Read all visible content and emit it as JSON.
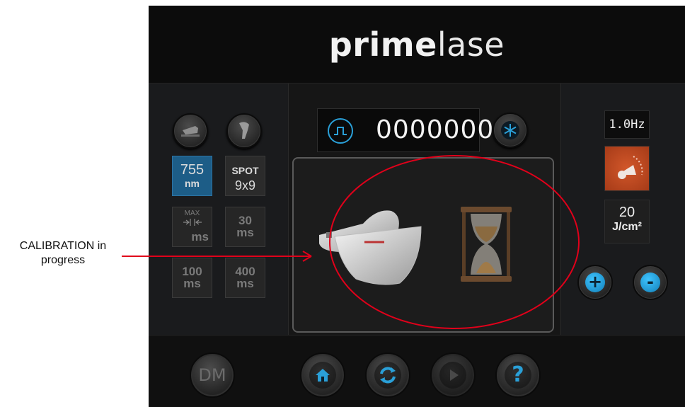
{
  "annotation": {
    "label_line1": "CALIBRATION in",
    "label_line2": "progress",
    "highlight_color": "#e1001a"
  },
  "header": {
    "logo_bold": "prime",
    "logo_light": "lase"
  },
  "left_panel": {
    "top_icons": [
      "handpiece-icon",
      "handpiece-alt-icon"
    ],
    "tiles": [
      {
        "big": "755",
        "small": "nm",
        "state": "selected"
      },
      {
        "big": "SPOT",
        "small": "9x9",
        "state": "normal"
      },
      {
        "big": "MAX",
        "small": "ms",
        "state": "dim"
      },
      {
        "big": "30",
        "small": "ms",
        "state": "dim"
      },
      {
        "big": "100",
        "small": "ms",
        "state": "dim"
      },
      {
        "big": "400",
        "small": "ms",
        "state": "dim"
      }
    ]
  },
  "counter": {
    "value": "0000000",
    "pulse_icon": "pulse-icon",
    "cooling_icon": "snowflake-icon"
  },
  "calibration": {
    "handpiece_icon": "handpiece-in-holder-icon",
    "hourglass_icon": "hourglass-icon"
  },
  "right_panel": {
    "frequency": "1.0Hz",
    "fluence_value": "20",
    "fluence_unit": "J/cm²",
    "plus_symbol": "+",
    "minus_symbol": "-",
    "dial_icon": "intensity-dial-icon"
  },
  "footer": {
    "dm_label": "DM",
    "home_icon": "home-icon",
    "refresh_icon": "refresh-icon",
    "play_icon": "play-icon",
    "help_symbol": "?"
  },
  "colors": {
    "accent_blue": "#2aa0d8",
    "selected_tile": "#1d5d87",
    "dial_orange": "#c94b21"
  }
}
